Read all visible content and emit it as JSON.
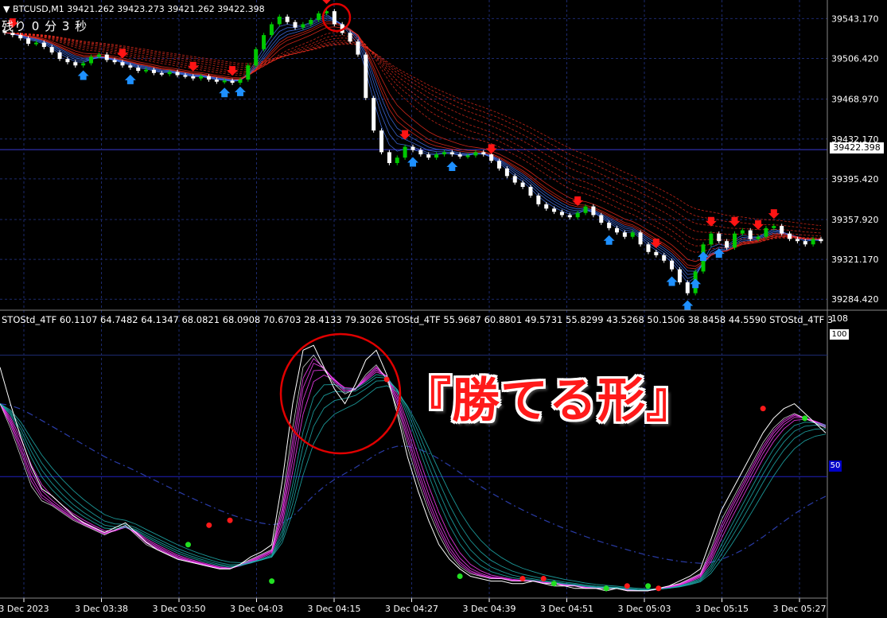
{
  "header": {
    "symbol_line": "▼ BTCUSD,M1  39421.262 39423.273 39421.262 39422.398",
    "timer": "残り 0 分 3 秒"
  },
  "indicator": {
    "label_line": "STOStd_4TF 60.1107 64.7482 64.1347 68.0821 68.0908 70.6703 28.4133 79.3026   STOStd_4TF 55.9687 60.8801 49.5731 55.8299 43.5268 50.1506 38.8458 44.5590   STOStd_4TF 3",
    "scale_top": "108",
    "scale_100": "100",
    "scale_50": "50"
  },
  "current_price": "39422.398",
  "caption": "『勝てる形』",
  "colors": {
    "background": "#000000",
    "grid": "#1c2a6e",
    "bull_candle": "#00c800",
    "bear_candle": "#ffffff",
    "sell_arrow": "#ff1414",
    "buy_arrow": "#1e90ff",
    "ribbon_warm": "#ff3020",
    "ribbon_cool": "#4a7cff",
    "stoch_fast": "#ff40ff",
    "stoch_slow": "#20b0b0",
    "highlight_circle": "#e00000"
  },
  "chart_data": [
    {
      "type": "candlestick",
      "title": "BTCUSD,M1",
      "y_ticks": [
        "39543.170",
        "39506.420",
        "39468.970",
        "39432.170",
        "39395.420",
        "39357.920",
        "39321.170",
        "39284.420"
      ],
      "ylim": [
        39278,
        39553
      ],
      "x_ticks": [
        "3 Dec 2023",
        "3 Dec 03:38",
        "3 Dec 03:50",
        "3 Dec 04:03",
        "3 Dec 04:15",
        "3 Dec 04:27",
        "3 Dec 04:39",
        "3 Dec 04:51",
        "3 Dec 05:03",
        "3 Dec 05:15",
        "3 Dec 05:27"
      ],
      "close": [
        39530,
        39528,
        39525,
        39520,
        39521,
        39517,
        39512,
        39506,
        39503,
        39500,
        39502,
        39508,
        39510,
        39505,
        39503,
        39500,
        39498,
        39495,
        39496,
        39493,
        39492,
        39494,
        39491,
        39490,
        39488,
        39490,
        39487,
        39485,
        39486,
        39484,
        39487,
        39500,
        39515,
        39528,
        39538,
        39545,
        39540,
        39535,
        39538,
        39542,
        39548,
        39550,
        39538,
        39530,
        39522,
        39510,
        39470,
        39440,
        39420,
        39410,
        39415,
        39425,
        39422,
        39418,
        39415,
        39418,
        39420,
        39418,
        39416,
        39417,
        39420,
        39418,
        39412,
        39405,
        39398,
        39392,
        39388,
        39380,
        39372,
        39368,
        39365,
        39362,
        39360,
        39364,
        39370,
        39362,
        39355,
        39350,
        39346,
        39342,
        39346,
        39335,
        39328,
        39325,
        39320,
        39312,
        39300,
        39290,
        39310,
        39335,
        39345,
        39338,
        39332,
        39345,
        39348,
        39340,
        39342,
        39350,
        39352,
        39345,
        39340,
        39338,
        39335,
        39340,
        39338
      ],
      "markers": {
        "sell": [
          1,
          15,
          24,
          29,
          41,
          51,
          62,
          73,
          83,
          90,
          93,
          96,
          98
        ],
        "buy": [
          10,
          16,
          28,
          30,
          52,
          57,
          77,
          85,
          87,
          88,
          89,
          91
        ]
      }
    },
    {
      "type": "line",
      "title": "STOStd_4TF",
      "ylim": [
        0,
        108
      ],
      "y_ticks": [
        "108",
        "100",
        "50"
      ],
      "series": [
        {
          "values": [
            80,
            70,
            58,
            46,
            40,
            38,
            35,
            32,
            30,
            28,
            26,
            28,
            30,
            26,
            22,
            20,
            18,
            16,
            15,
            14,
            13,
            12,
            12,
            14,
            16,
            18,
            20,
            40,
            70,
            95,
            100,
            94,
            88,
            84,
            86,
            92,
            96,
            90,
            78,
            62,
            48,
            36,
            26,
            18,
            13,
            10,
            9,
            8,
            8,
            7,
            7,
            7,
            6,
            6,
            5,
            5,
            4,
            4,
            4,
            4,
            3,
            3,
            3,
            4,
            5,
            6,
            8,
            10,
            20,
            32,
            40,
            48,
            56,
            64,
            70,
            74,
            76,
            74,
            72,
            70
          ]
        },
        {
          "values": [
            95,
            80,
            66,
            54,
            45,
            42,
            38,
            34,
            31,
            29,
            27,
            29,
            31,
            27,
            23,
            20,
            18,
            16,
            15,
            14,
            13,
            12,
            12,
            14,
            17,
            19,
            22,
            48,
            80,
            102,
            104,
            95,
            86,
            80,
            88,
            98,
            102,
            92,
            76,
            58,
            44,
            32,
            22,
            16,
            12,
            9,
            8,
            7,
            7,
            6,
            6,
            7,
            6,
            5,
            5,
            4,
            4,
            4,
            3,
            4,
            3,
            3,
            3,
            4,
            5,
            7,
            9,
            12,
            24,
            36,
            44,
            52,
            60,
            68,
            74,
            78,
            80,
            76,
            72,
            68
          ]
        }
      ],
      "dots": {
        "red": [
          [
            20,
            30
          ],
          [
            22,
            32
          ],
          [
            37,
            90
          ],
          [
            50,
            8
          ],
          [
            52,
            8
          ],
          [
            60,
            5
          ],
          [
            63,
            4
          ],
          [
            73,
            78
          ]
        ],
        "green": [
          [
            18,
            22
          ],
          [
            26,
            7
          ],
          [
            44,
            9
          ],
          [
            53,
            6
          ],
          [
            58,
            4
          ],
          [
            62,
            5
          ],
          [
            77,
            74
          ]
        ]
      }
    }
  ]
}
